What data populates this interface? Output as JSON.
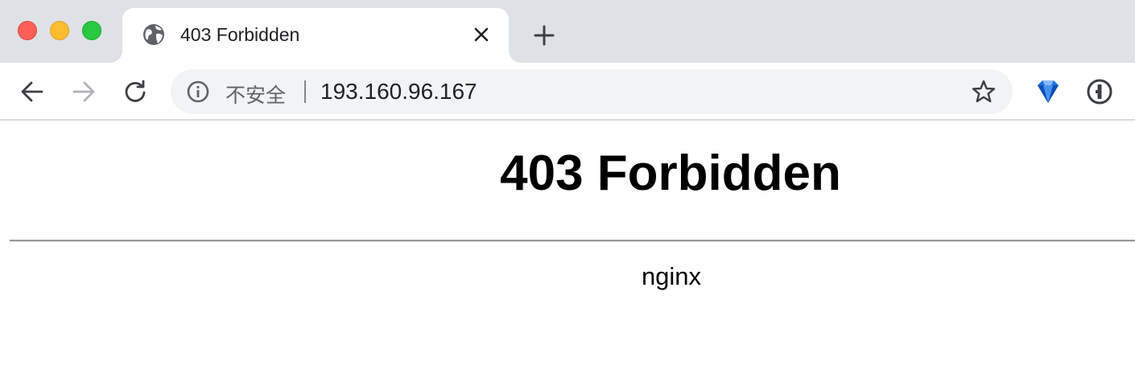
{
  "window": {
    "controls": [
      "close",
      "minimize",
      "maximize"
    ]
  },
  "tab": {
    "title": "403 Forbidden",
    "favicon": "globe-icon",
    "close_icon": "close-icon"
  },
  "new_tab_icon": "plus-icon",
  "toolbar": {
    "back_icon": "arrow-left-icon",
    "forward_icon": "arrow-right-icon",
    "reload_icon": "reload-icon",
    "omnibox": {
      "security_icon": "info-icon",
      "security_label": "不安全",
      "url": "193.160.96.167",
      "bookmark_icon": "star-icon"
    },
    "extensions": [
      "diamond-extension-icon",
      "password-manager-icon"
    ]
  },
  "page": {
    "heading": "403 Forbidden",
    "footer": "nginx"
  },
  "colors": {
    "tabstrip": "#dee1e6",
    "omnibox": "#f1f3f4",
    "close": "#ff5f57",
    "minimize": "#febc2e",
    "maximize": "#28c840",
    "extension_blue": "#1a73e8"
  }
}
